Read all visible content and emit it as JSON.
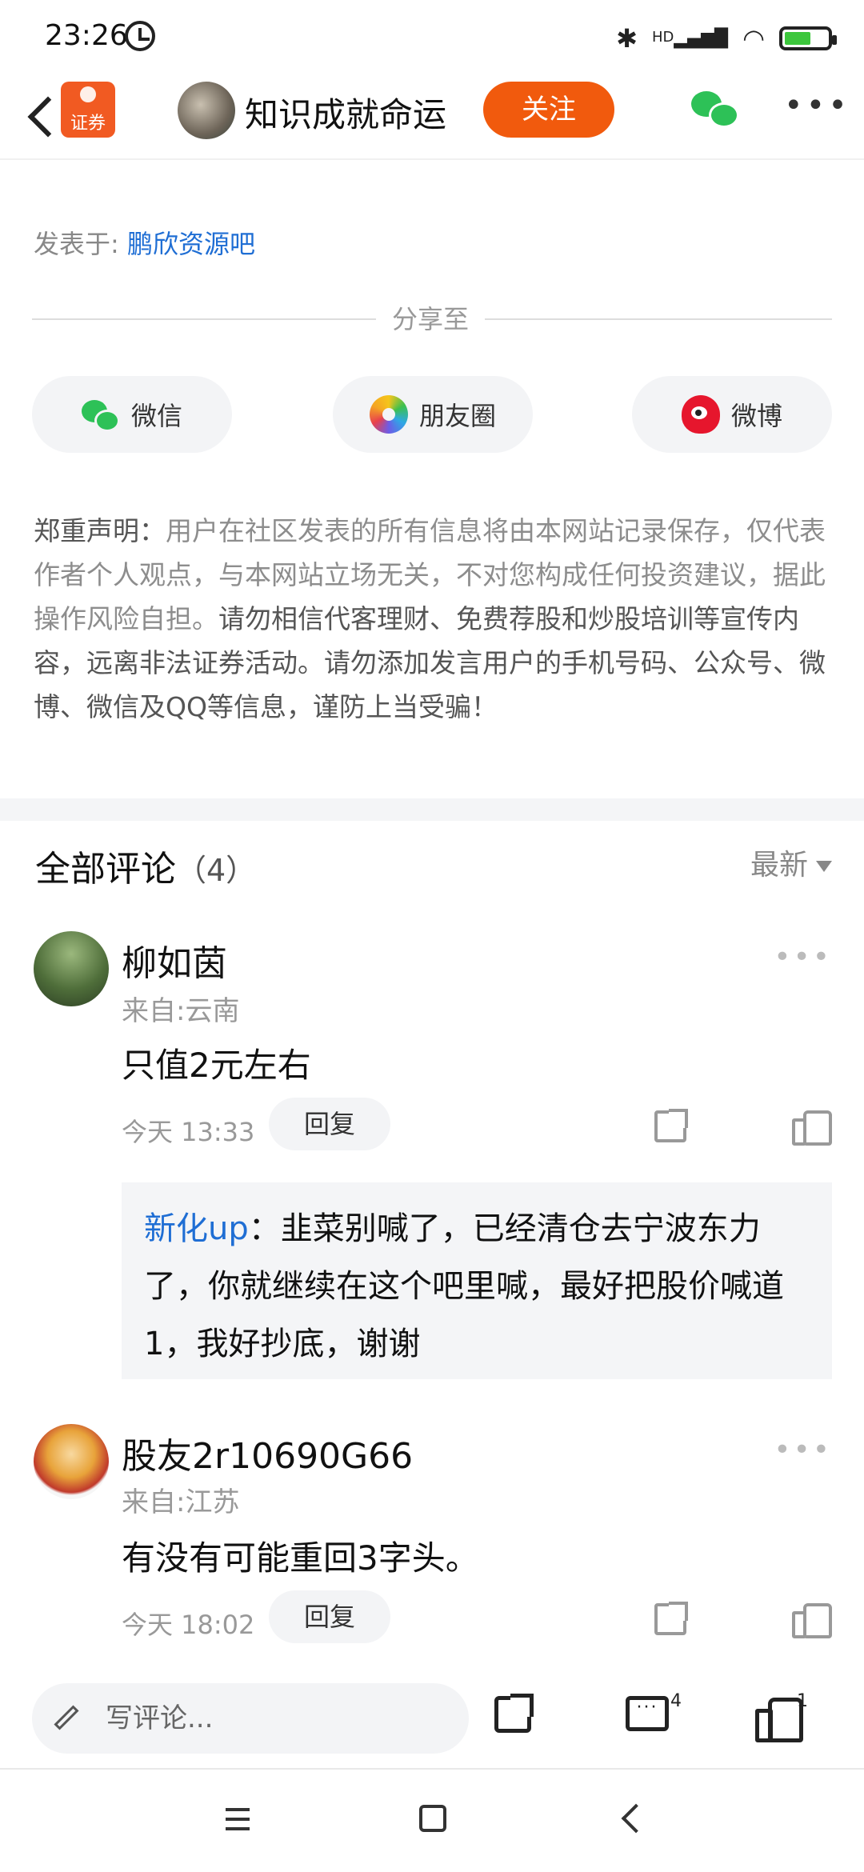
{
  "status_bar": {
    "time": "23:26",
    "network": "HD"
  },
  "header": {
    "logo_text": "证券",
    "username": "知识成就命运",
    "follow_label": "关注"
  },
  "post": {
    "posted_prefix": "发表于: ",
    "posted_in": "鹏欣资源吧",
    "share_label": "分享至",
    "share_targets": [
      {
        "label": "微信",
        "icon": "wechat-icon"
      },
      {
        "label": "朋友圈",
        "icon": "moments-icon"
      },
      {
        "label": "微博",
        "icon": "weibo-icon"
      }
    ],
    "notice_heading": "郑重声明：",
    "notice_body": "用户在社区发表的所有信息将由本网站记录保存，仅代表作者个人观点，与本网站立场无关，不对您构成任何投资建议，据此操作风险自担。",
    "notice_warning": "请勿相信代客理财、免费荐股和炒股培训等宣传内容，远离非法证券活动。请勿添加发言用户的手机号码、公众号、微博、微信及QQ等信息，谨防上当受骗！"
  },
  "comments_section": {
    "title": "全部评论",
    "count": "（4）",
    "sort": "最新",
    "comments": [
      {
        "name": "柳如茵",
        "from": "来自:云南",
        "text": "只值2元左右",
        "time": "今天 13:33",
        "reply_label": "回复",
        "sub_reply": {
          "author": "新化up",
          "text": "：韭菜别喊了，已经清仓去宁波东力了，你就继续在这个吧里喊，最好把股价喊道1，我好抄底，谢谢"
        }
      },
      {
        "name": "股友2r10690G66",
        "from": "来自:江苏",
        "text": "有没有可能重回3字头。",
        "time": "今天 18:02",
        "reply_label": "回复"
      }
    ]
  },
  "bottom_bar": {
    "write_placeholder": "写评论...",
    "comment_count": "4",
    "like_count": "1"
  },
  "colors": {
    "accent": "#f15a0d",
    "link": "#1f6ed4",
    "wechat": "#2dc157"
  }
}
